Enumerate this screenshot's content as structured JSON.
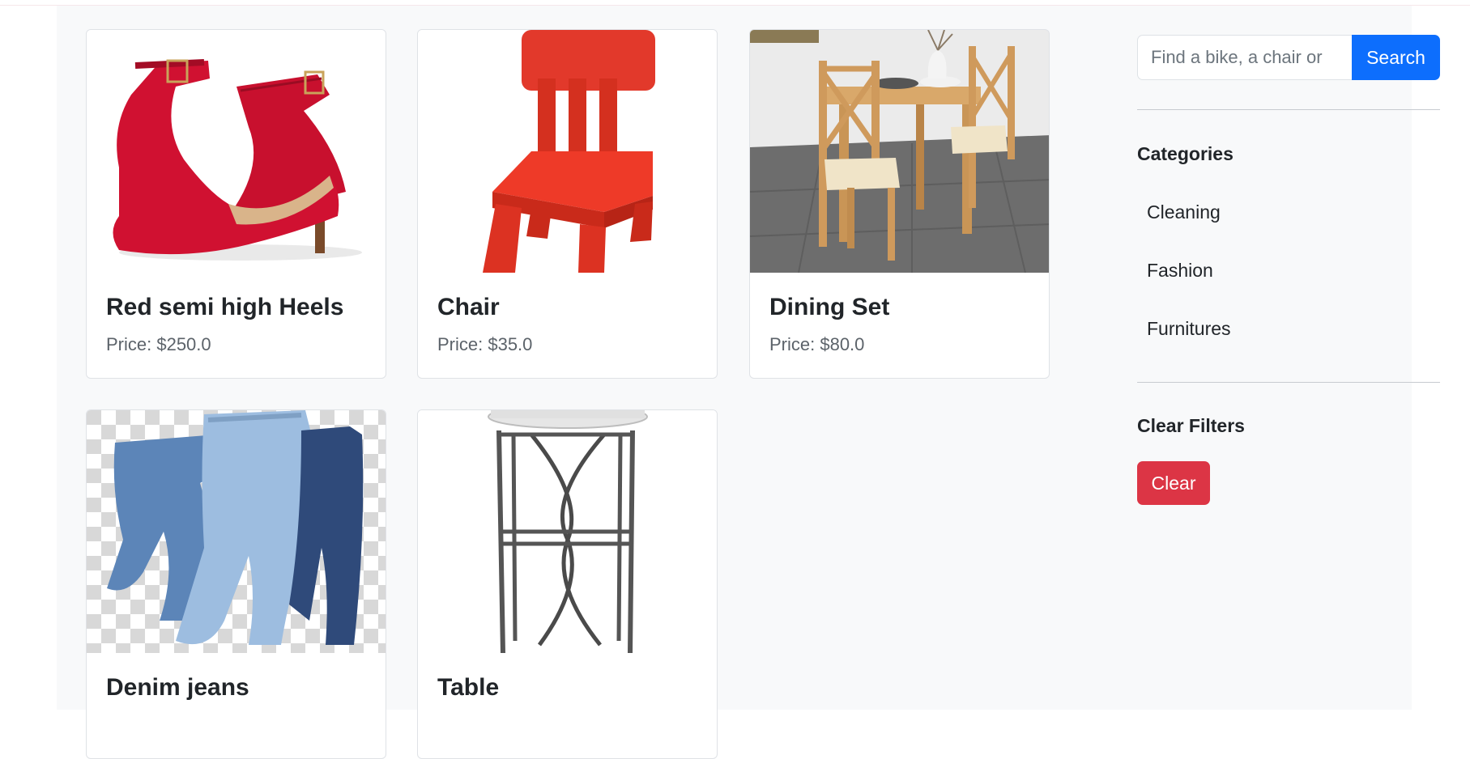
{
  "search": {
    "placeholder": "Find a bike, a chair or",
    "button_label": "Search"
  },
  "products": [
    {
      "title": "Red semi high Heels",
      "price": "Price: $250.0"
    },
    {
      "title": "Chair",
      "price": "Price: $35.0"
    },
    {
      "title": "Dining Set",
      "price": "Price: $80.0"
    },
    {
      "title": "Denim jeans"
    },
    {
      "title": "Table"
    }
  ],
  "sidebar": {
    "categories_heading": "Categories",
    "categories": [
      "Cleaning",
      "Fashion",
      "Furnitures"
    ],
    "clear_heading": "Clear Filters",
    "clear_button": "Clear"
  },
  "colors": {
    "primary": "#0d6efd",
    "danger": "#dc3545",
    "background": "#f8f9fa"
  }
}
